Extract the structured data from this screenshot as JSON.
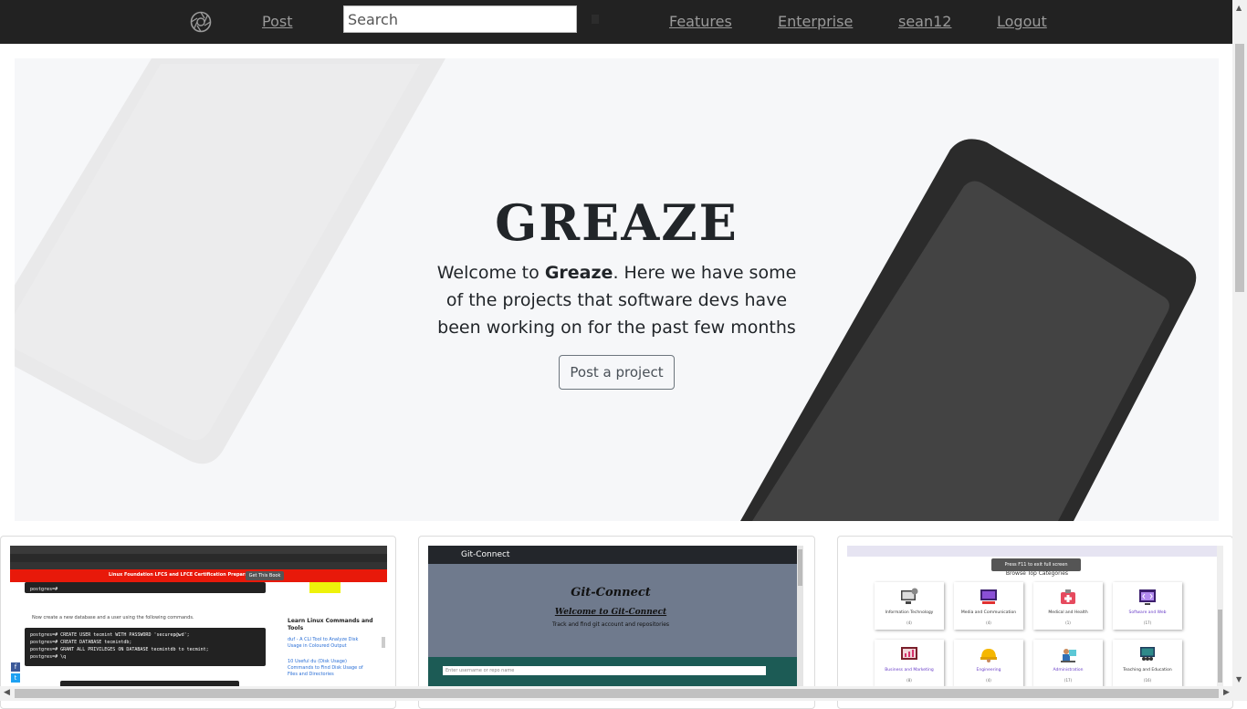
{
  "nav": {
    "logo_icon": "aperture-logo-icon",
    "post": "Post",
    "search_placeholder": "Search",
    "search_icon": "search-submit-icon",
    "features": "Features",
    "enterprise": "Enterprise",
    "user": "sean12",
    "logout": "Logout",
    "background_color": "#222222",
    "link_color": "#9a9a9a"
  },
  "hero": {
    "title": "GREAZE",
    "text_before": "Welcome to ",
    "text_bold": "Greaze",
    "text_after": ". Here we have some of the projects that software devs have been working on for the past few months",
    "button": "Post a project",
    "background_color": "#f6f7f9"
  },
  "projects": [
    {
      "banner": "Linux Foundation LFCS and LFCE Certification Preparation Guide",
      "banner_button": "Get This Book",
      "text": "Now create a new database and a user using the following commands.",
      "prompt": "postgres=#",
      "commands": [
        "postgres=# CREATE USER tecmint WITH PASSWORD 'securep@wd';",
        "postgres=# CREATE DATABASE tecmintdb;",
        "postgres=# GRANT ALL PRIVILEGES ON DATABASE tecmintdb to tecmint;",
        "postgres=# \\q"
      ],
      "sidebar_title": "Learn Linux Commands and Tools",
      "sidebar_links": [
        "duf - A CLI Tool to Analyze Disk Usage in Coloured Output",
        "10 Useful du (Disk Usage) Commands to Find Disk Usage of Files and Directories"
      ]
    },
    {
      "brand": "Git-Connect",
      "title": "Git-Connect",
      "subtitle": "Welcome to Git-Connect",
      "description": "Track and find git account and repositories",
      "input_placeholder": "Enter username or repo name"
    },
    {
      "toast": "Press F11 to exit full screen",
      "heading": "Browse Top Categories",
      "categories": [
        {
          "label": "Information Technology",
          "count": "(4)",
          "icon": "computer-gear-icon"
        },
        {
          "label": "Media and Communication",
          "count": "(4)",
          "icon": "media-screen-icon"
        },
        {
          "label": "Medical and Health",
          "count": "(1)",
          "icon": "medical-bag-icon"
        },
        {
          "label": "Software and Web",
          "count": "(17)",
          "icon": "code-window-icon"
        },
        {
          "label": "Business and Marketing",
          "count": "(8)",
          "icon": "chart-board-icon"
        },
        {
          "label": "Engineering",
          "count": "(4)",
          "icon": "hard-hat-icon"
        },
        {
          "label": "Administration",
          "count": "(17)",
          "icon": "office-worker-icon"
        },
        {
          "label": "Teaching and Education",
          "count": "(16)",
          "icon": "teaching-board-icon"
        }
      ]
    }
  ]
}
